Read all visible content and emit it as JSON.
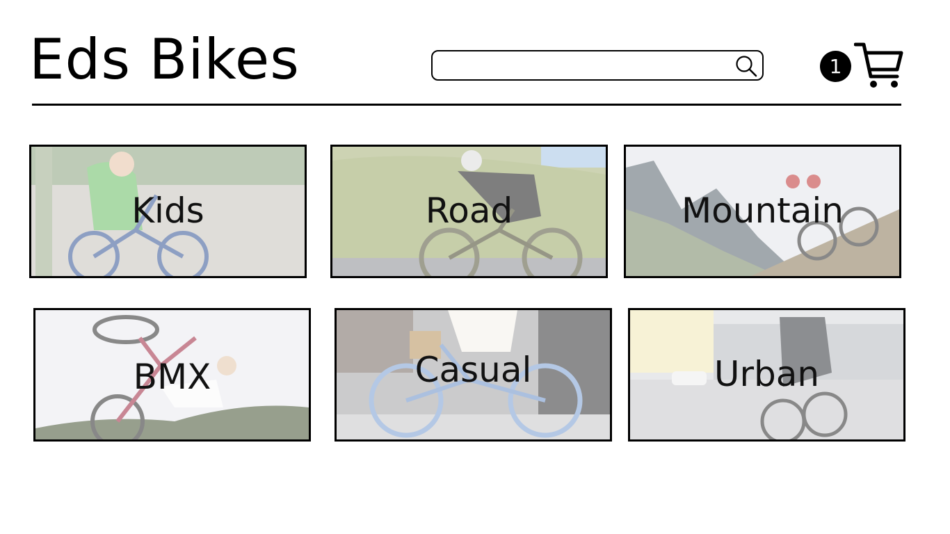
{
  "header": {
    "title": "Eds Bikes",
    "search": {
      "value": "",
      "placeholder": "",
      "icon": "search-icon"
    },
    "cart": {
      "count": "1",
      "icon": "cart-icon"
    }
  },
  "categories": [
    {
      "label": "Kids"
    },
    {
      "label": "Road"
    },
    {
      "label": "Mountain"
    },
    {
      "label": "BMX"
    },
    {
      "label": "Casual"
    },
    {
      "label": "Urban"
    }
  ],
  "colors": {
    "text": "#000000",
    "background": "#ffffff",
    "border": "#000000"
  }
}
